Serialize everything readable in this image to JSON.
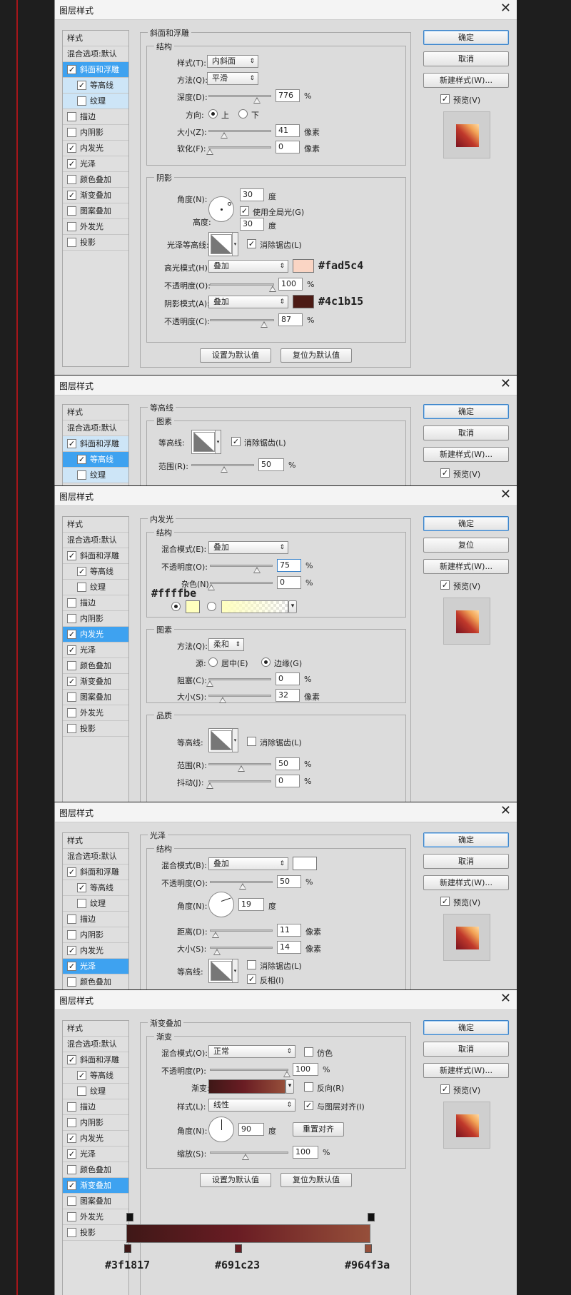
{
  "dialogs": {
    "title": "图层样式",
    "close": "✕",
    "ok": "确定",
    "cancel": "取消",
    "reset": "复位",
    "new_style": "新建样式(W)...",
    "preview": "预览(V)",
    "set_default": "设置为默认值",
    "reset_default": "复位为默认值"
  },
  "styles": {
    "header": "样式",
    "blend": "混合选项:默认",
    "bevel": "斜面和浮雕",
    "contour": "等高线",
    "texture": "纹理",
    "stroke": "描边",
    "inner_shadow": "内阴影",
    "inner_glow": "内发光",
    "satin": "光泽",
    "color_overlay": "颜色叠加",
    "gradient_overlay": "渐变叠加",
    "pattern_overlay": "图案叠加",
    "outer_glow": "外发光",
    "drop_shadow": "投影"
  },
  "bevel": {
    "section": "斜面和浮雕",
    "structure": "结构",
    "style_label": "样式(T):",
    "style": "内斜面",
    "technique_label": "方法(Q):",
    "technique": "平滑",
    "depth_label": "深度(D):",
    "depth": "776",
    "pct": "%",
    "direction_label": "方向:",
    "up": "上",
    "down": "下",
    "size_label": "大小(Z):",
    "size": "41",
    "px": "像素",
    "soften_label": "软化(F):",
    "soften": "0",
    "shading": "阴影",
    "angle_label": "角度(N):",
    "angle": "30",
    "deg": "度",
    "global": "使用全局光(G)",
    "altitude_label": "高度:",
    "altitude": "30",
    "gloss_label": "光泽等高线:",
    "antialias": "消除锯齿(L)",
    "hl_mode_label": "高光模式(H):",
    "hl_mode": "叠加",
    "hl_color": "#fad5c4",
    "hl_note": "#fad5c4",
    "hl_op_label": "不透明度(O):",
    "hl_op": "100",
    "sh_mode_label": "阴影模式(A):",
    "sh_mode": "叠加",
    "sh_color": "#4c1b15",
    "sh_note": "#4c1b15",
    "sh_op_label": "不透明度(C):",
    "sh_op": "87"
  },
  "contour": {
    "section": "等高线",
    "elements": "图素",
    "contour_label": "等高线:",
    "antialias": "消除锯齿(L)",
    "range_label": "范围(R):",
    "range": "50",
    "pct": "%"
  },
  "inner_glow": {
    "section": "内发光",
    "structure": "结构",
    "blend_label": "混合模式(E):",
    "blend": "叠加",
    "op_label": "不透明度(O):",
    "op": "75",
    "pct": "%",
    "noise_label": "杂色(N):",
    "noise": "0",
    "color_note": "#ffffbe",
    "color": "#ffffbe",
    "elements": "图素",
    "technique_label": "方法(Q):",
    "technique": "柔和",
    "source_label": "源:",
    "center": "居中(E)",
    "edge": "边缘(G)",
    "choke_label": "阻塞(C):",
    "choke": "0",
    "size_label": "大小(S):",
    "size": "32",
    "px": "像素",
    "quality": "品质",
    "contour_label": "等高线:",
    "antialias": "消除锯齿(L)",
    "range_label": "范围(R):",
    "range": "50",
    "jitter_label": "抖动(J):",
    "jitter": "0"
  },
  "satin": {
    "section": "光泽",
    "structure": "结构",
    "blend_label": "混合模式(B):",
    "blend": "叠加",
    "op_label": "不透明度(O):",
    "op": "50",
    "pct": "%",
    "angle_label": "角度(N):",
    "angle": "19",
    "deg": "度",
    "distance_label": "距离(D):",
    "distance": "11",
    "px": "像素",
    "size_label": "大小(S):",
    "size": "14",
    "contour_label": "等高线:",
    "antialias": "消除锯齿(L)",
    "invert": "反相(I)"
  },
  "gradient": {
    "section": "渐变叠加",
    "sub": "渐变",
    "blend_label": "混合模式(O):",
    "blend": "正常",
    "dither": "仿色",
    "op_label": "不透明度(P):",
    "op": "100",
    "pct": "%",
    "grad_label": "渐变:",
    "reverse": "反向(R)",
    "style_label": "样式(L):",
    "style": "线性",
    "align": "与图层对齐(I)",
    "angle_label": "角度(N):",
    "angle": "90",
    "deg": "度",
    "reset_align": "重置对齐",
    "scale_label": "缩放(S):",
    "scale": "100",
    "stops": [
      "#3f1817",
      "#691c23",
      "#964f3a"
    ]
  }
}
